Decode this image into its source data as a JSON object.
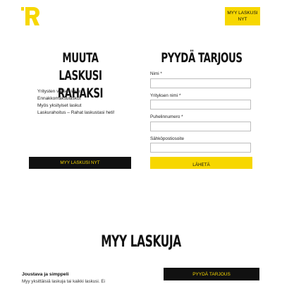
{
  "header": {
    "logo_icon": "r-logo-icon",
    "cta_label": "MYY LASKUSI NYT"
  },
  "left": {
    "title": "MUUTA LASKUSI RAHAKSI",
    "features": [
      "Yritysten väliset laskut",
      "Ennakkomaksulaskut",
      "Myös yksityiset laskut",
      "Laskurahoitus – Rahat laskustasi heti!"
    ],
    "cta_label": "MYY LASKUSI NYT"
  },
  "form": {
    "title": "PYYDÄ TARJOUS",
    "fields": [
      {
        "label": "Nimi *",
        "value": ""
      },
      {
        "label": "Yrityksen nimi *",
        "value": ""
      },
      {
        "label": "Puhelinnumero *",
        "value": ""
      },
      {
        "label": "Sähköpostiosoite",
        "value": ""
      }
    ],
    "submit_label": "LÄHETÄ"
  },
  "sell": {
    "title": "MYY LASKUJA",
    "subheading": "Joustava ja simppeli",
    "paragraph": "Myy yksittäisiä laskuja tai kaikki laskusi. Ei",
    "offer_label": "PYYDÄ TARJOUS"
  },
  "colors": {
    "accent": "#f7d700",
    "dark": "#111111"
  }
}
